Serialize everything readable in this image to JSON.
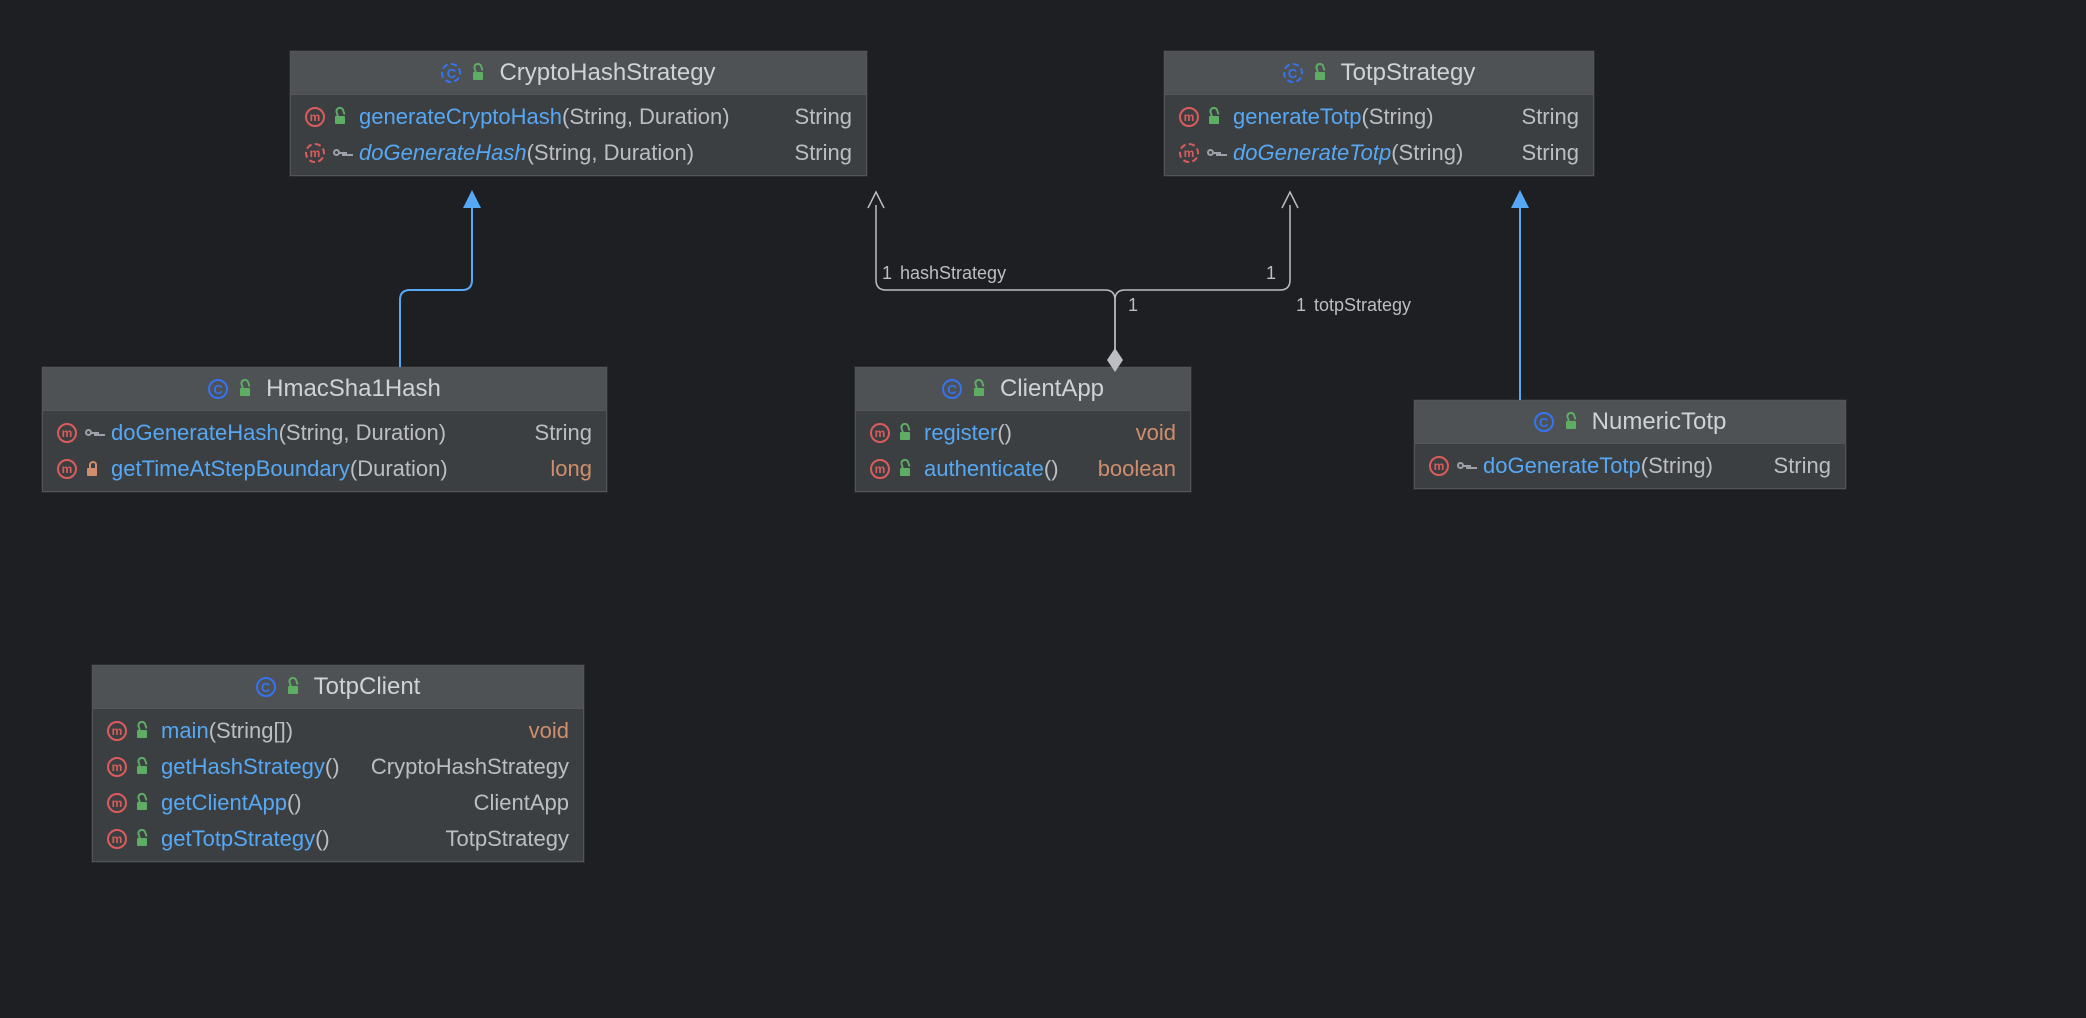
{
  "classes": {
    "cryptoHash": {
      "name": "CryptoHashStrategy",
      "abstract": true,
      "members": [
        {
          "abstract": false,
          "vis": "public",
          "name": "generateCryptoHash",
          "params": "(String, Duration)",
          "ret": "String",
          "retKw": false
        },
        {
          "abstract": true,
          "vis": "protected",
          "name": "doGenerateHash",
          "params": "(String, Duration)",
          "ret": "String",
          "retKw": false
        }
      ]
    },
    "totpStrategy": {
      "name": "TotpStrategy",
      "abstract": true,
      "members": [
        {
          "abstract": false,
          "vis": "public",
          "name": "generateTotp",
          "params": "(String)",
          "ret": "String",
          "retKw": false
        },
        {
          "abstract": true,
          "vis": "protected",
          "name": "doGenerateTotp",
          "params": "(String)",
          "ret": "String",
          "retKw": false
        }
      ]
    },
    "hmac": {
      "name": "HmacSha1Hash",
      "abstract": false,
      "members": [
        {
          "abstract": false,
          "vis": "protected",
          "name": "doGenerateHash",
          "params": "(String, Duration)",
          "ret": "String",
          "retKw": false
        },
        {
          "abstract": false,
          "vis": "private",
          "name": "getTimeAtStepBoundary",
          "params": "(Duration)",
          "ret": "long",
          "retKw": true
        }
      ]
    },
    "clientApp": {
      "name": "ClientApp",
      "abstract": false,
      "members": [
        {
          "abstract": false,
          "vis": "public",
          "name": "register",
          "params": "()",
          "ret": "void",
          "retKw": true
        },
        {
          "abstract": false,
          "vis": "public",
          "name": "authenticate",
          "params": "()",
          "ret": "boolean",
          "retKw": true
        }
      ]
    },
    "numeric": {
      "name": "NumericTotp",
      "abstract": false,
      "members": [
        {
          "abstract": false,
          "vis": "protected",
          "name": "doGenerateTotp",
          "params": "(String)",
          "ret": "String",
          "retKw": false
        }
      ]
    },
    "totpClient": {
      "name": "TotpClient",
      "abstract": false,
      "members": [
        {
          "abstract": false,
          "vis": "public",
          "name": "main",
          "params": "(String[])",
          "ret": "void",
          "retKw": true
        },
        {
          "abstract": false,
          "vis": "public",
          "name": "getHashStrategy",
          "params": "()",
          "ret": "CryptoHashStrategy",
          "retKw": false
        },
        {
          "abstract": false,
          "vis": "public",
          "name": "getClientApp",
          "params": "()",
          "ret": "ClientApp",
          "retKw": false
        },
        {
          "abstract": false,
          "vis": "public",
          "name": "getTotpStrategy",
          "params": "()",
          "ret": "TotpStrategy",
          "retKw": false
        }
      ]
    }
  },
  "labels": {
    "hashStrategy": "hashStrategy",
    "totpStrategy": "totpStrategy",
    "one": "1"
  }
}
